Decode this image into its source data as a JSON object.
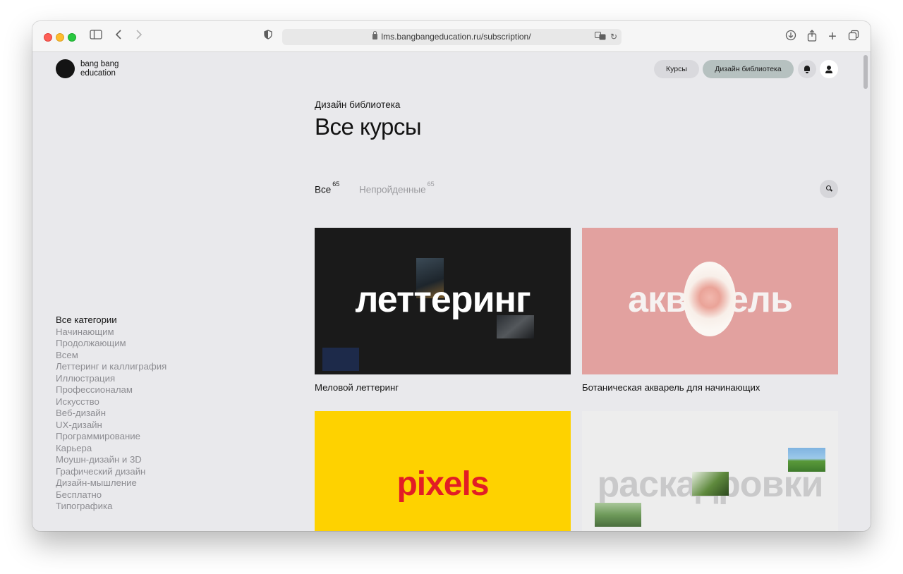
{
  "browser": {
    "url": "lms.bangbangeducation.ru/subscription/"
  },
  "site": {
    "logo_line1": "bang bang",
    "logo_line2": "education"
  },
  "nav": {
    "courses_label": "Курсы",
    "library_label": "Дизайн библиотека"
  },
  "header": {
    "breadcrumb": "Дизайн библиотека",
    "title": "Все курсы"
  },
  "tabs": [
    {
      "label": "Все",
      "count": "65"
    },
    {
      "label": "Непройденные",
      "count": "65"
    }
  ],
  "categories": [
    "Все категории",
    "Начинающим",
    "Продолжающим",
    "Всем",
    "Леттеринг и каллиграфия",
    "Иллюстрация",
    "Профессионалам",
    "Искусство",
    "Веб-дизайн",
    "UX-дизайн",
    "Программирование",
    "Карьера",
    "Моушн-дизайн и 3D",
    "Графический дизайн",
    "Дизайн-мышление",
    "Бесплатно",
    "Типографика"
  ],
  "courses": [
    {
      "cover_word": "леттеринг",
      "title": "Меловой леттеринг",
      "cover_color": "#1a1a1a"
    },
    {
      "cover_word": "акварель",
      "title": "Ботаническая акварель для начинающих",
      "cover_color": "#e2a19f"
    },
    {
      "cover_word": "pixels",
      "title": "",
      "cover_color": "#fed200"
    },
    {
      "cover_word": "раскадровки",
      "title": "",
      "cover_color": "#ededed"
    }
  ]
}
